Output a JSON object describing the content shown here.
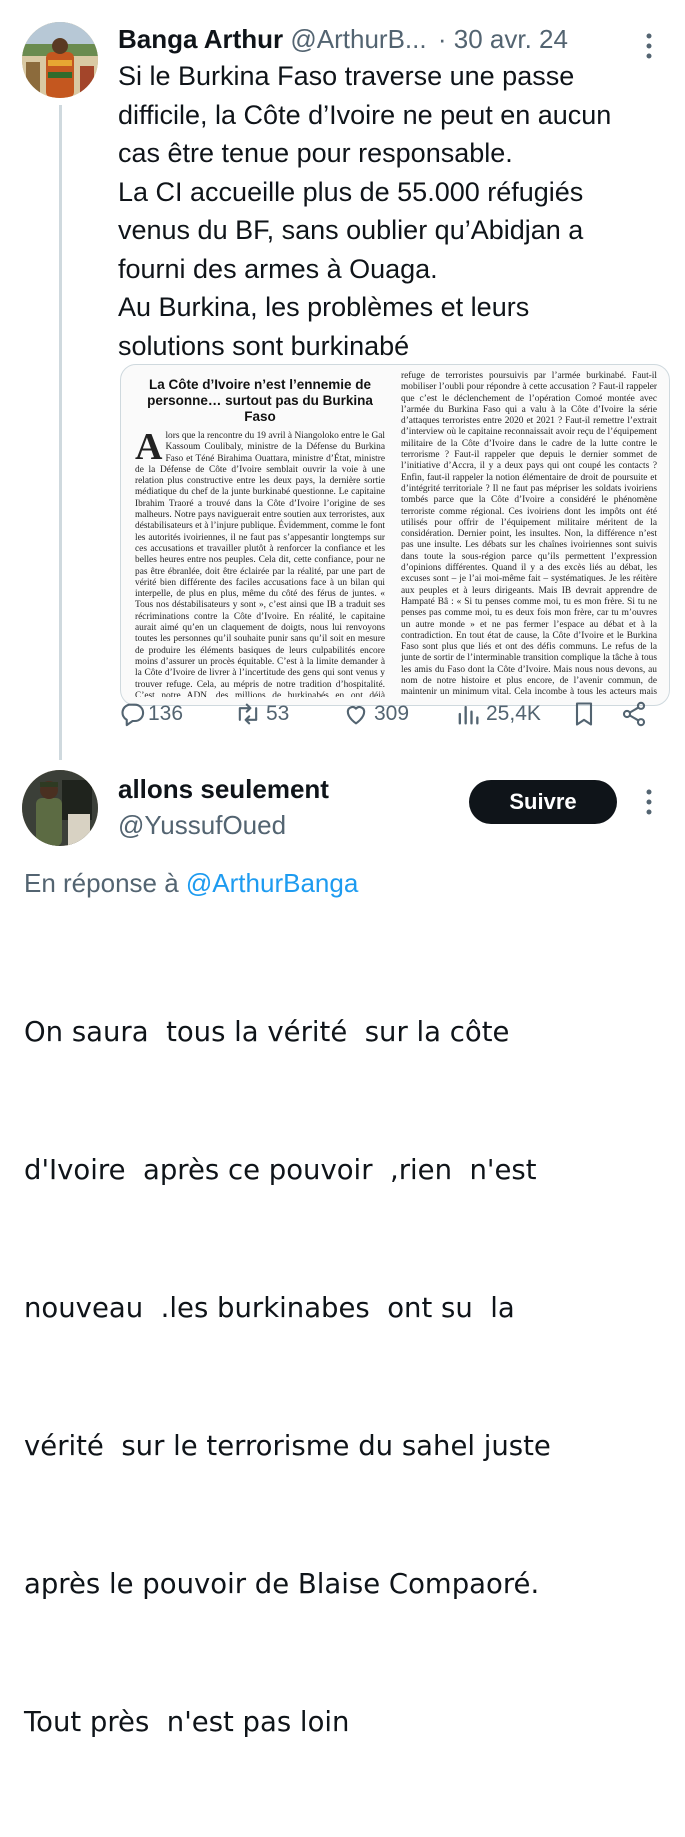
{
  "tweet1": {
    "author_name": "Banga Arthur",
    "handle": "@ArthurB...",
    "separator": "·",
    "date": "30 avr. 24",
    "text_lines": [
      "Si le Burkina Faso traverse une passe",
      "difficile, la Côte d’Ivoire ne peut en aucun",
      "cas être tenue pour responsable.",
      "La CI accueille plus de 55.000 réfugiés",
      "venus du BF, sans oublier qu’Abidjan a",
      "fourni des armes à Ouaga.",
      "Au Burkina, les problèmes et leurs",
      "solutions sont burkinabé"
    ],
    "media": {
      "headline": "La Côte d’Ivoire n’est l’ennemie de personne… surtout pas du Burkina Faso",
      "left_column": "lors que la rencontre du 19 avril à Niangoloko entre le Gal Kassoum Coulibaly, ministre de la Défense du Burkina Faso et Téné Birahima Ouattara, ministre d’État, ministre de la Défense de Côte d’Ivoire semblait ouvrir la voie à une relation plus constructive entre les deux pays, la dernière sortie médiatique du chef de la junte burkinabé questionne. Le capitaine Ibrahim Traoré a trouvé dans la Côte d’Ivoire l’origine de ses malheurs. Notre pays naviguerait entre soutien aux terroristes, aux déstabilisateurs et à l’injure publique. Évidemment, comme le font les autorités ivoiriennes, il ne faut pas s’appesantir longtemps sur ces accusations et travailler plutôt à renforcer la confiance et les belles heures entre nos peuples. Cela dit, cette confiance, pour ne pas être ébranlée, doit être éclairée par la réalité, par une part de vérité bien différente des faciles accusations face à un bilan qui interpelle, de plus en plus, même du côté des férus de juntes. « Tous nos déstabilisateurs y sont », c’est ainsi que IB a traduit ses récriminations contre la Côte d’Ivoire. En réalité, le capitaine aurait aimé qu’en un claquement de doigts, nous lui renvoyons toutes les personnes qu’il souhaite punir sans qu’il soit en mesure de produire les éléments basiques de leurs culpabilités encore moins d’assurer un procès équitable. C’est à la limite demander à la Côte d’Ivoire de livrer à l’incertitude des gens qui sont venus y trouver refuge. Cela, au mépris de notre tradition d’hospitalité. C’est notre ADN, des millions de burkinabés en ont déjà bénéficié, il est hors de question que nous trahissions cette tradition. C’est même une tradition africaine, une tradition que nous pourrions tous solliciter. Damiba l’a sollicitée au Togo, Compaoré en Côte d’Ivoire autant de situations qui devraient tous nous amener à la retenue.",
      "right_column": "refuge de terroristes poursuivis par l’armée burkinabé. Faut-il mobiliser l’oubli pour répondre à cette accusation ? Faut-il rappeler que c’est le déclenchement de l’opération Comoé montée avec l’armée du Burkina Faso qui a valu à la Côte d’Ivoire la série d’attaques terroristes entre 2020 et 2021 ? Faut-il remettre l’extrait d’interview où le capitaine reconnaissait avoir reçu de l’équipement militaire de la Côte d’Ivoire dans le cadre de la lutte contre le terrorisme ? Faut-il rappeler que depuis le dernier sommet de l’initiative d’Accra, il y a deux pays qui ont coupé les contacts ? Enfin, faut-il rappeler la notion élémentaire de droit de poursuite et d’intégrité territoriale ? Il ne faut pas mépriser les soldats ivoiriens tombés parce que la Côte d’Ivoire a considéré le phénomène terroriste comme régional. Ces ivoiriens dont les impôts ont été utilisés pour offrir de l’équipement militaire méritent de la considération. Dernier point, les insultes. Non, la différence n’est pas une insulte. Les débats sur les chaînes ivoiriennes sont suivis dans toute la sous-région parce qu’ils permettent l’expression d’opinions différentes. Quand il y a des excès liés au débat, les excuses sont – je l’ai moi-même fait – systématiques. Je les réitère aux peuples et à leurs dirigeants. Mais IB devrait apprendre de Hampaté Bâ : « Si tu penses comme moi, tu es mon frère. Si tu ne penses pas comme moi, tu es deux fois mon frère, car tu m’ouvres un autre monde » et ne pas fermer l’espace au débat et à la contradiction. En tout état de cause, la Côte d’Ivoire et le Burkina Faso sont plus que liés et ont des défis communs. Le refus de la junte de sortir de l’interminable transition complique la tâche à tous les amis du Faso dont la Côte d’Ivoire. Mais nous nous devons, au nom de notre histoire et plus encore, de l’avenir commun, de maintenir un minimum vital. Cela incombe à tous les acteurs mais encore plus aux autorités qui doivent faire preuve de modération y compris dans le langage."
    },
    "actions": {
      "replies": "136",
      "retweets": "53",
      "likes": "309",
      "views": "25,4K"
    }
  },
  "tweet2": {
    "author_name": "allons seulement",
    "handle": "@YussufOued",
    "follow_label": "Suivre",
    "reply_prefix": "En réponse à",
    "reply_to": "@ArthurBanga",
    "text_lines": [
      "On saura  tous la vérité  sur la côte",
      "d'Ivoire  après ce pouvoir  ,rien  n'est",
      "nouveau  .les burkinabes  ont su  la",
      "vérité  sur le terrorisme du sahel juste",
      "après le pouvoir de Blaise Compaoré.",
      "Tout près  n'est pas loin"
    ]
  },
  "icons": [
    "more-icon",
    "reply-icon",
    "retweet-icon",
    "like-icon",
    "views-icon",
    "bookmark-icon",
    "share-icon"
  ],
  "colors": {
    "link": "#1d9bf0",
    "text": "#0f1419",
    "muted": "#536471",
    "follow_bg": "#0f1419"
  }
}
